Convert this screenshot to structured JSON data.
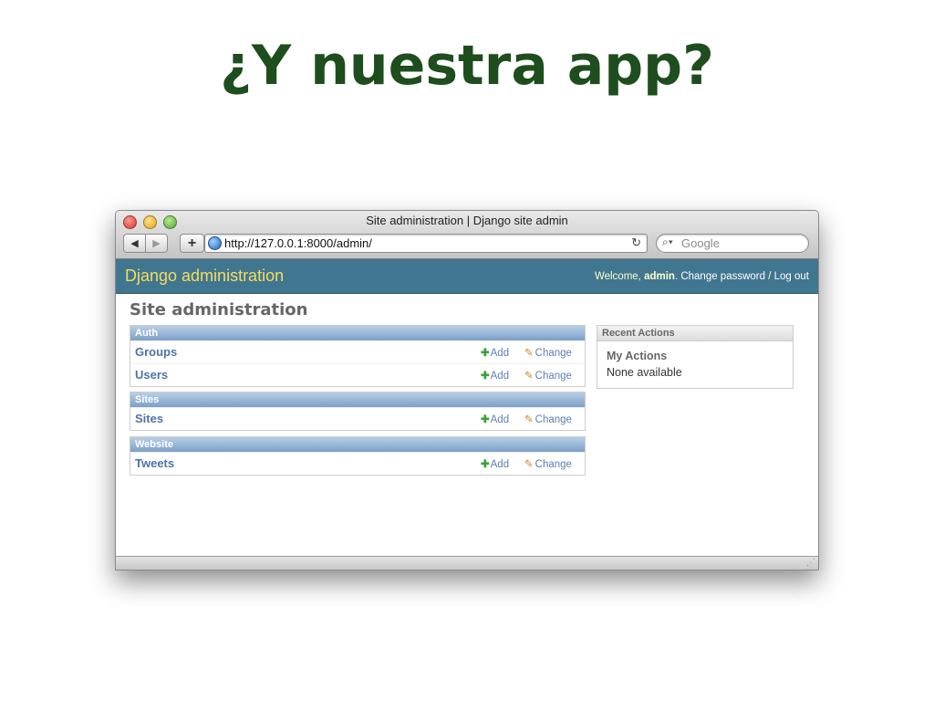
{
  "slide": {
    "title": "¿Y nuestra app?"
  },
  "browser": {
    "window_title": "Site administration | Django site admin",
    "back_icon": "◀",
    "forward_icon": "▶",
    "new_tab_icon": "+",
    "url": "http://127.0.0.1:8000/admin/",
    "reload_icon": "↻",
    "search_icon": "⌕▾",
    "search_placeholder": "Google"
  },
  "admin": {
    "branding": "Django administration",
    "user_tools": {
      "welcome": "Welcome, ",
      "username": "admin",
      "dot": ". ",
      "change_password": "Change password",
      "separator": " / ",
      "logout": "Log out"
    },
    "page_title": "Site administration",
    "add_icon": "✚",
    "change_icon": "✎",
    "add_label": "Add",
    "change_label": "Change",
    "modules": [
      {
        "caption": "Auth",
        "models": [
          {
            "name": "Groups"
          },
          {
            "name": "Users"
          }
        ]
      },
      {
        "caption": "Sites",
        "models": [
          {
            "name": "Sites"
          }
        ]
      },
      {
        "caption": "Website",
        "models": [
          {
            "name": "Tweets"
          }
        ]
      }
    ],
    "recent_actions": {
      "caption": "Recent Actions",
      "heading": "My Actions",
      "empty": "None available"
    }
  }
}
